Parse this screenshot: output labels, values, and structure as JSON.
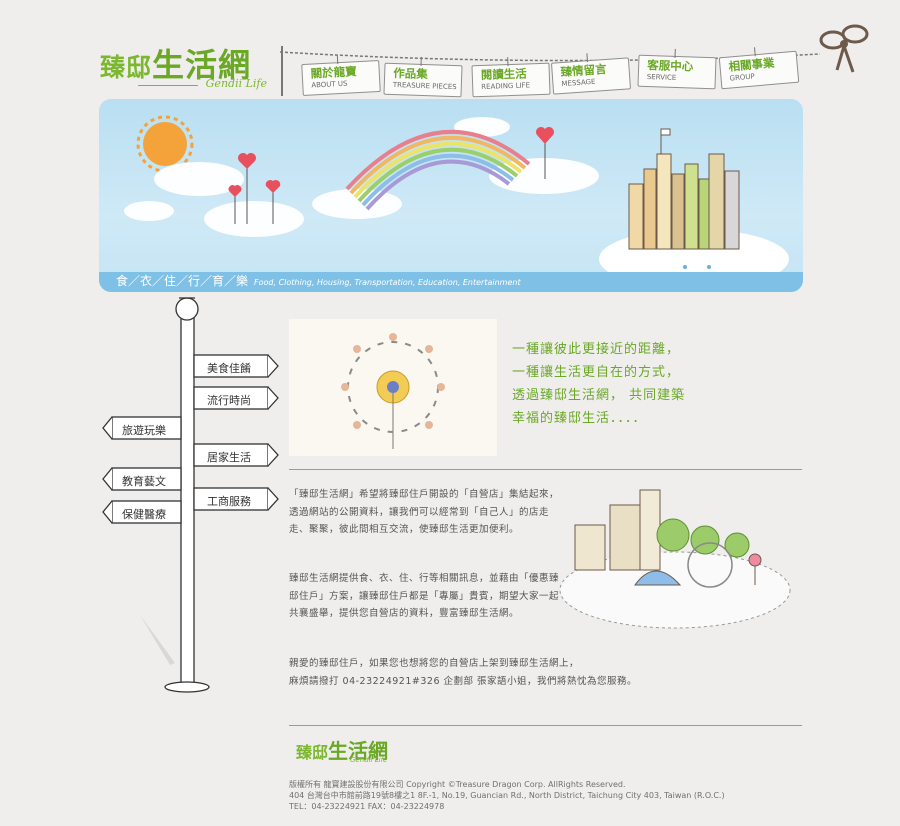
{
  "logo": {
    "name_part1": "臻邸",
    "name_part2": "生活網",
    "sub": "Gendii Life"
  },
  "nav": [
    {
      "zh": "關於龍寶",
      "en": "ABOUT US"
    },
    {
      "zh": "作品集",
      "en": "TREASURE PIECES"
    },
    {
      "zh": "閱讀生活",
      "en": "READING LIFE"
    },
    {
      "zh": "臻情留言",
      "en": "MESSAGE"
    },
    {
      "zh": "客服中心",
      "en": "SERVICE"
    },
    {
      "zh": "相關事業",
      "en": "GROUP"
    }
  ],
  "banner": {
    "caption_zh": "食／衣／住／行／育／樂",
    "caption_en": "Food, Clothing, Housing, Transportation, Education, Entertainment"
  },
  "signpost": [
    "美食佳餚",
    "流行時尚",
    "旅遊玩樂",
    "居家生活",
    "教育藝文",
    "工商服務",
    "保健醫療"
  ],
  "slogan": [
    "一種讓彼此更接近的距離，",
    "一種讓生活更自在的方式，",
    "透過臻邸生活網， 共同建築",
    "幸福的臻邸生活．．．．"
  ],
  "paragraphs": {
    "p1": "「臻邸生活網」希望將臻邸住戶開設的「自營店」集結起來，透過網站的公開資料，讓我們可以經常到「自己人」的店走走、聚聚，彼此間相互交流，使臻邸生活更加便利。",
    "p2": "臻邸生活網提供食、衣、住、行等相關訊息，並藉由「優惠臻邸住戶」方案，讓臻邸住戶都是「專屬」貴賓，期望大家一起共襄盛舉，提供您自營店的資料，豐富臻邸生活網。",
    "p3_line1": "親愛的臻邸住戶，如果您也想將您的自營店上架到臻邸生活網上，",
    "p3_line2": "麻煩請撥打 04-23224921#326 企劃部 張家語小姐，我們將熱忱為您服務。"
  },
  "footer": {
    "logo_part1": "臻邸",
    "logo_part2": "生活網",
    "logo_sub": "Gendii Life",
    "line1": "版權所有 龍寶建設股份有限公司   Copyright ©Treasure Dragon Corp. AllRights Reserved.",
    "line2": "404 台灣台中市館前路19號8樓之1   8F.-1, No.19, Guancian Rd., North District, Taichung City 403, Taiwan (R.O.C.)",
    "line3": "TEL：04-23224921    FAX：04-23224978"
  },
  "colors": {
    "brand_green": "#6aa826",
    "sky_blue": "#b9dff2",
    "strip_blue": "#7fc1e6",
    "background": "#efeeec"
  }
}
